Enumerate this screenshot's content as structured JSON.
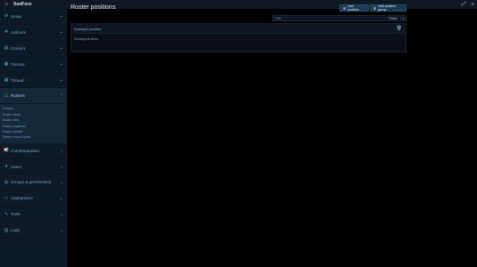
{
  "app": {
    "brand": "XenForo"
  },
  "topbar": {
    "home_icon": "home-icon",
    "actions": [
      "expand-icon",
      "search-icon"
    ]
  },
  "sidebar": {
    "items": [
      {
        "label": "Setup",
        "icon": "gear-icon"
      },
      {
        "label": "Add-ons",
        "icon": "puzzle-icon"
      },
      {
        "label": "Content",
        "icon": "file-icon"
      },
      {
        "label": "Forums",
        "icon": "forum-icon"
      },
      {
        "label": "Thread",
        "icon": "thread-icon"
      },
      {
        "label": "Rosters",
        "icon": "roster-icon",
        "active": true
      },
      {
        "label": "Communication",
        "icon": "megaphone-icon"
      },
      {
        "label": "Users",
        "icon": "user-icon"
      },
      {
        "label": "Groups & permissions",
        "icon": "users-icon"
      },
      {
        "label": "Appearance",
        "icon": "palette-icon"
      },
      {
        "label": "Tools",
        "icon": "wrench-icon"
      },
      {
        "label": "Logs",
        "icon": "log-icon"
      }
    ],
    "subitems": [
      "Rosters",
      "Roster fields",
      "Roster tabs",
      "Roster positions",
      "Roster people",
      "Roster record types"
    ]
  },
  "main": {
    "title": "Roster positions",
    "add_position": "Add position",
    "add_position_group": "Add position group",
    "filter": {
      "placeholder": "Filter",
      "prefix": "Prefix",
      "clear": "×"
    },
    "rows": [
      {
        "label": "Example position"
      }
    ],
    "footer": "Showing an items"
  }
}
